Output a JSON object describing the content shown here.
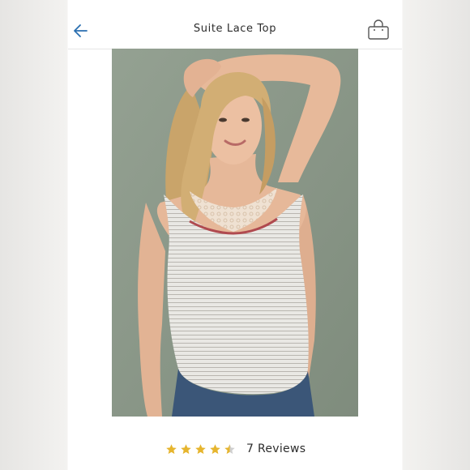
{
  "header": {
    "title": "Suite Lace Top",
    "back_icon": "arrow-left-icon",
    "bag_icon": "shopping-bag-icon",
    "accent_color": "#2a6fb0"
  },
  "product": {
    "image_alt": "Suite Lace Top",
    "rating": 4.5,
    "rating_max": 5,
    "star_color": "#e6b52e",
    "reviews_label": "7 Reviews"
  }
}
